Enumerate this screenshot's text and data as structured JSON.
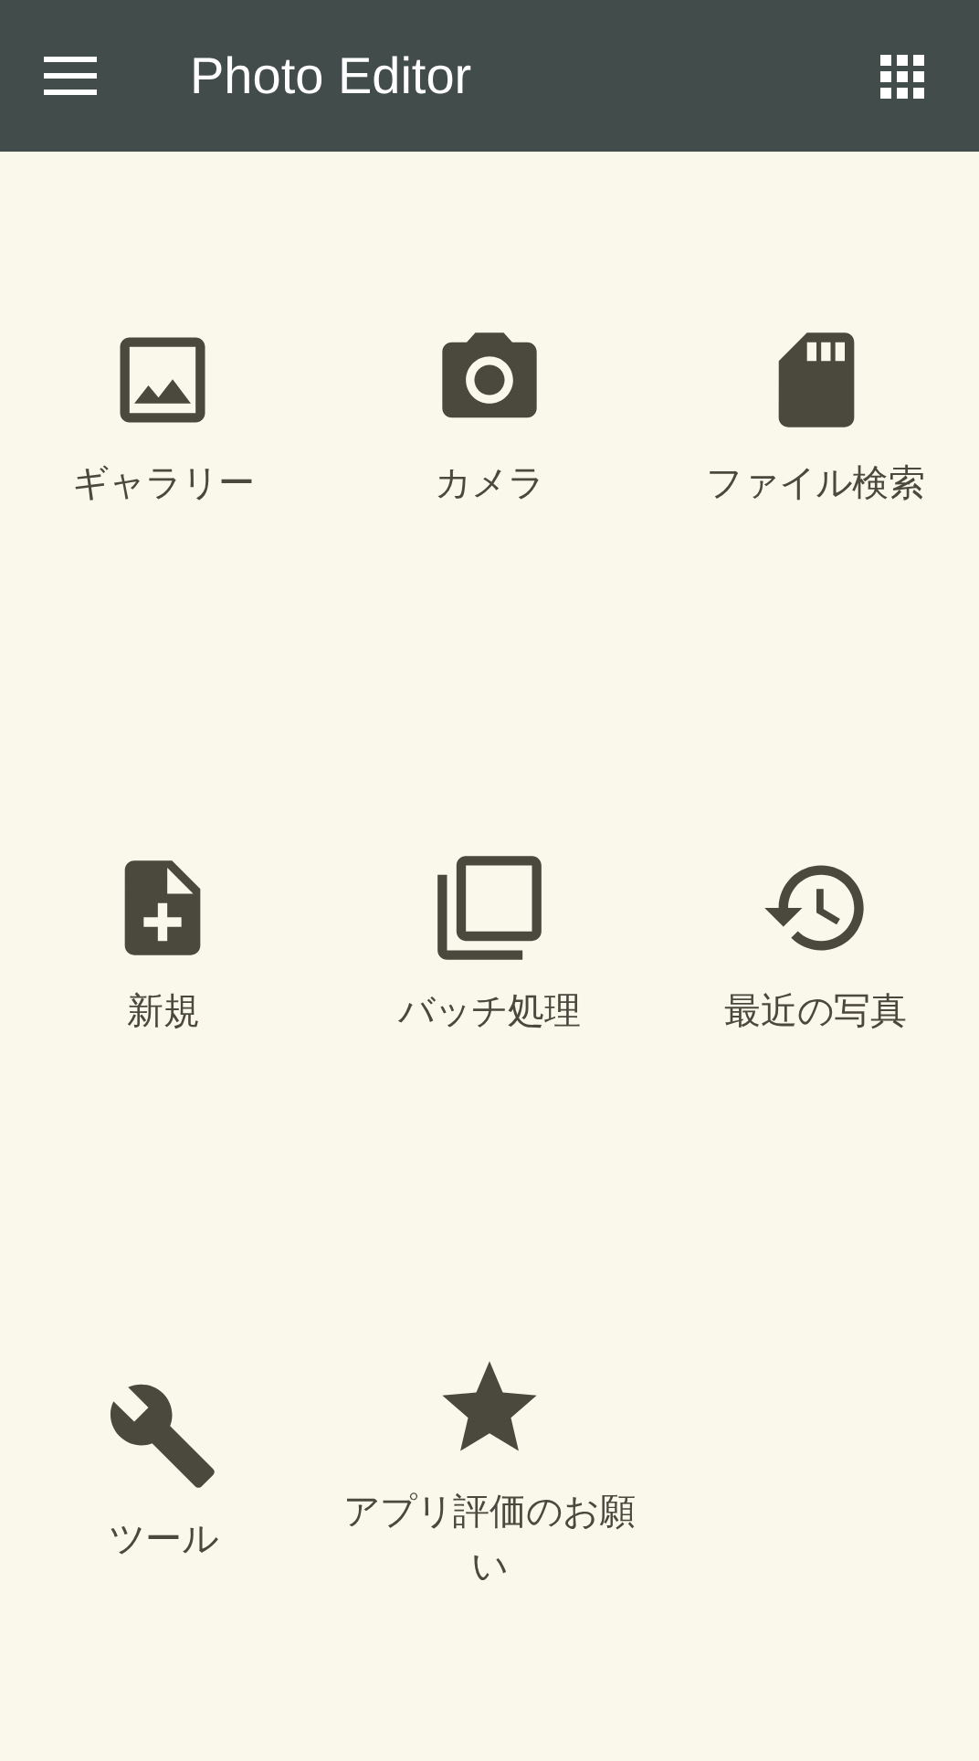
{
  "app_bar": {
    "title": "Photo Editor"
  },
  "tiles": [
    {
      "label": "ギャラリー"
    },
    {
      "label": "カメラ"
    },
    {
      "label": "ファイル検索"
    },
    {
      "label": "新規"
    },
    {
      "label": "バッチ処理"
    },
    {
      "label": "最近の写真"
    },
    {
      "label": "ツール"
    },
    {
      "label": "アプリ評価のお願い"
    }
  ]
}
